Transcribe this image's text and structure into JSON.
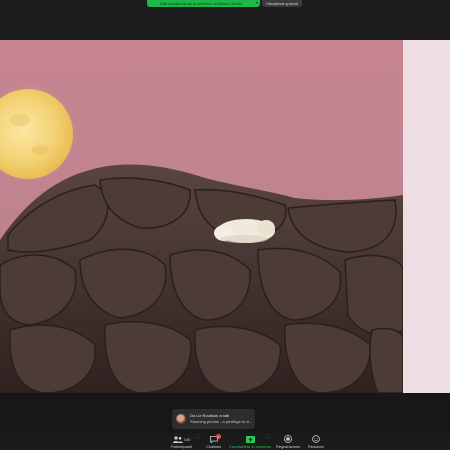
{
  "share_bar": {
    "status_label": "Stai visualizzando lo schermo di Marco Gentili",
    "view_options_label": "Visualizza opzioni",
    "colors": {
      "share_green": "#1eb84a",
      "bar_bg": "#1c1c1c"
    }
  },
  "shared_content": {
    "image_subject": "full moon over polar bear resting on rocky outcrop against pink sky",
    "colors": {
      "sky": "#c3868f",
      "moon": "#f2cf6a",
      "rock": "#4a3a35",
      "side_panel": "#eedde2"
    }
  },
  "chat_toast": {
    "sender": "Da Liz Roulston a tutti",
    "message": "Stunning photos - a privilege to vi..."
  },
  "toolbar": {
    "participants_label": "Partecipanti",
    "participants_count": "140",
    "chat_label": "Chattare",
    "chat_badge": "1",
    "share_label": "Condividere lo schermo",
    "record_label": "Registrazione",
    "reactions_label": "Reazioni",
    "icons": [
      "participants-icon",
      "chat-icon",
      "share-screen-icon",
      "record-icon",
      "reactions-icon"
    ],
    "colors": {
      "share_active": "#2ec85a"
    }
  }
}
